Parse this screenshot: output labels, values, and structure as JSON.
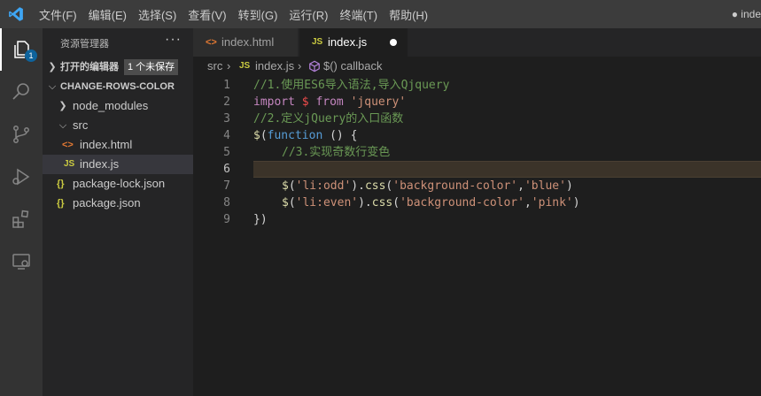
{
  "menu": {
    "file": "文件(F)",
    "edit": "编辑(E)",
    "selection": "选择(S)",
    "view": "查看(V)",
    "goto": "转到(G)",
    "run": "运行(R)",
    "terminal": "终端(T)",
    "help": "帮助(H)"
  },
  "window_title": "● inde",
  "activity": {
    "explorer_badge": "1"
  },
  "sidebar": {
    "title": "资源管理器",
    "more": "···",
    "open_editors": {
      "label": "打开的编辑器",
      "tag": "1 个未保存"
    },
    "project": "CHANGE-ROWS-COLOR",
    "tree": [
      {
        "label": "node_modules"
      },
      {
        "label": "src"
      },
      {
        "label": "index.html",
        "icon": "<>"
      },
      {
        "label": "index.js",
        "icon": "JS"
      },
      {
        "label": "package-lock.json",
        "icon": "{}"
      },
      {
        "label": "package.json",
        "icon": "{}"
      }
    ]
  },
  "tabs": [
    {
      "label": "index.html",
      "icon": "<>"
    },
    {
      "label": "index.js",
      "icon": "JS"
    }
  ],
  "breadcrumb": {
    "folder": "src",
    "file_icon": "JS",
    "file": "index.js",
    "symbol": "$() callback"
  },
  "code": {
    "line_numbers": [
      "1",
      "2",
      "3",
      "4",
      "5",
      "6",
      "7",
      "8",
      "9"
    ],
    "l1": "//1.使用ES6导入语法,导入Qjquery",
    "l2_import": "import",
    "l2_dollar": "$",
    "l2_from": "from",
    "l2_str": "'jquery'",
    "l3": "//2.定义jQuery的入口函数",
    "l4_dollar": "$",
    "l4_paren": "(",
    "l4_function": "function",
    "l4_rest": " () {",
    "l5": "//3.实现奇数行变色",
    "l7_dollar": "$",
    "l7_p1": "(",
    "l7_s1": "'li:odd'",
    "l7_p2": ").",
    "l7_css": "css",
    "l7_p3": "(",
    "l7_s2": "'background-color'",
    "l7_comma": ",",
    "l7_s3": "'blue'",
    "l7_p4": ")",
    "l8_dollar": "$",
    "l8_p1": "(",
    "l8_s1": "'li:even'",
    "l8_p2": ").",
    "l8_css": "css",
    "l8_p3": "(",
    "l8_s2": "'background-color'",
    "l8_comma": ",",
    "l8_s3": "'pink'",
    "l8_p4": ")",
    "l9": "})"
  },
  "colors": {
    "titlebar": "#3c3c3c",
    "activity_bar": "#333333",
    "sidebar": "#252526",
    "editor": "#1e1e1e",
    "comment": "#6a9955",
    "keyword": "#c586c0",
    "string": "#ce9178",
    "badge": "#0e639c"
  }
}
